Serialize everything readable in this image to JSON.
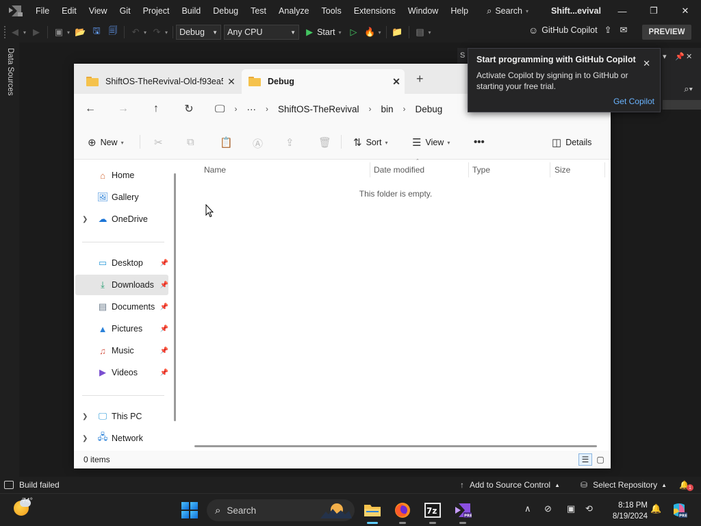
{
  "vs": {
    "menu": [
      "File",
      "Edit",
      "View",
      "Git",
      "Project",
      "Build",
      "Debug",
      "Test",
      "Analyze",
      "Tools",
      "Extensions",
      "Window",
      "Help"
    ],
    "search_label": "Search",
    "window_title": "Shift...evival",
    "toolbar": {
      "config": "Debug",
      "platform": "Any CPU",
      "start_label": "Start",
      "copilot_label": "GitHub Copilot",
      "preview_label": "PREVIEW"
    },
    "side_tab": "Data Sources",
    "panel_clip": "S",
    "statusbar": {
      "build": "Build failed",
      "source_control": "Add to Source Control",
      "repository": "Select Repository",
      "notifications": "1"
    }
  },
  "copilot_popup": {
    "title": "Start programming with GitHub Copilot",
    "body": "Activate Copilot by signing in to GitHub or starting your free trial.",
    "link": "Get Copilot"
  },
  "explorer": {
    "tabs": [
      {
        "label": "ShiftOS-TheRevival-Old-f93ea5",
        "active": false
      },
      {
        "label": "Debug",
        "active": true
      }
    ],
    "breadcrumb": [
      "ShiftOS-TheRevival",
      "bin",
      "Debug"
    ],
    "commands": {
      "new": "New",
      "sort": "Sort",
      "view": "View",
      "details": "Details"
    },
    "nav": {
      "top": [
        {
          "label": "Home",
          "icon": "home-icon"
        },
        {
          "label": "Gallery",
          "icon": "gallery-icon"
        },
        {
          "label": "OneDrive",
          "icon": "cloud-icon"
        }
      ],
      "quick": [
        {
          "label": "Desktop",
          "icon": "desktop-icon"
        },
        {
          "label": "Downloads",
          "icon": "download-icon"
        },
        {
          "label": "Documents",
          "icon": "documents-icon"
        },
        {
          "label": "Pictures",
          "icon": "pictures-icon"
        },
        {
          "label": "Music",
          "icon": "music-icon"
        },
        {
          "label": "Videos",
          "icon": "videos-icon"
        }
      ],
      "bottom": [
        {
          "label": "This PC",
          "icon": "pc-icon"
        },
        {
          "label": "Network",
          "icon": "network-icon"
        }
      ]
    },
    "columns": [
      "Name",
      "Date modified",
      "Type",
      "Size"
    ],
    "empty_message": "This folder is empty.",
    "status": "0 items"
  },
  "taskbar": {
    "weather_temp": "74°",
    "search_label": "Search",
    "time": "8:18 PM",
    "date": "8/19/2024"
  },
  "colors": {
    "vs_bg": "#1f1f1f",
    "accent_link": "#6ab4ff",
    "folder": "#f5c24c",
    "start_green": "#43c460"
  }
}
